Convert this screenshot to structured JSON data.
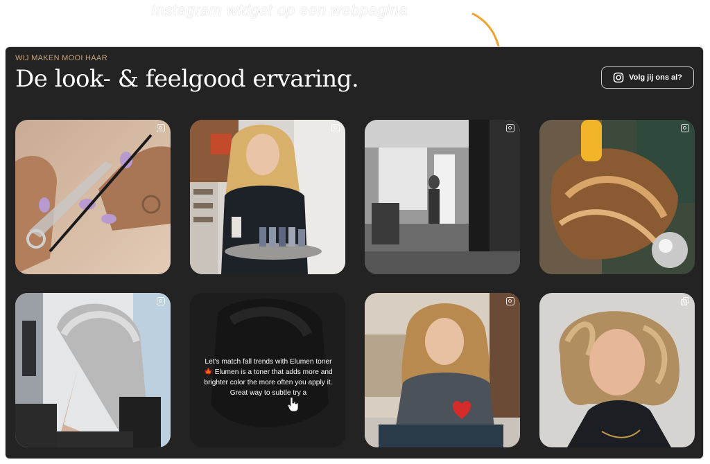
{
  "caption": "Instagram widget op een webpagina",
  "widget": {
    "eyebrow": "WIJ MAKEN MOOI HAAR",
    "title": "De look- & feelgood ervaring.",
    "follow_label": "Volg jij ons al?",
    "posts": [
      {
        "subject": "scissors-and-comb",
        "badge": "instagram-icon"
      },
      {
        "subject": "woman-with-nail-polish",
        "badge": "instagram-icon"
      },
      {
        "subject": "salon-black-white",
        "badge": "instagram-icon"
      },
      {
        "subject": "hair-washing",
        "badge": "instagram-icon"
      },
      {
        "subject": "grey-pixie-cut",
        "badge": "instagram-icon"
      },
      {
        "subject": "text-post",
        "text": "Let's match fall trends with Elumen toner 🍁 Elumen is a toner that adds more and brighter color the more often you apply it. Great way to subtle try a",
        "badge": "none"
      },
      {
        "subject": "curly-hair-laughing",
        "badge": "instagram-icon"
      },
      {
        "subject": "curly-bob-portrait",
        "badge": "carousel-icon"
      }
    ]
  },
  "colors": {
    "panel_bg": "#232323",
    "eyebrow": "#c7a27a",
    "arrow": "#f0a22c"
  }
}
